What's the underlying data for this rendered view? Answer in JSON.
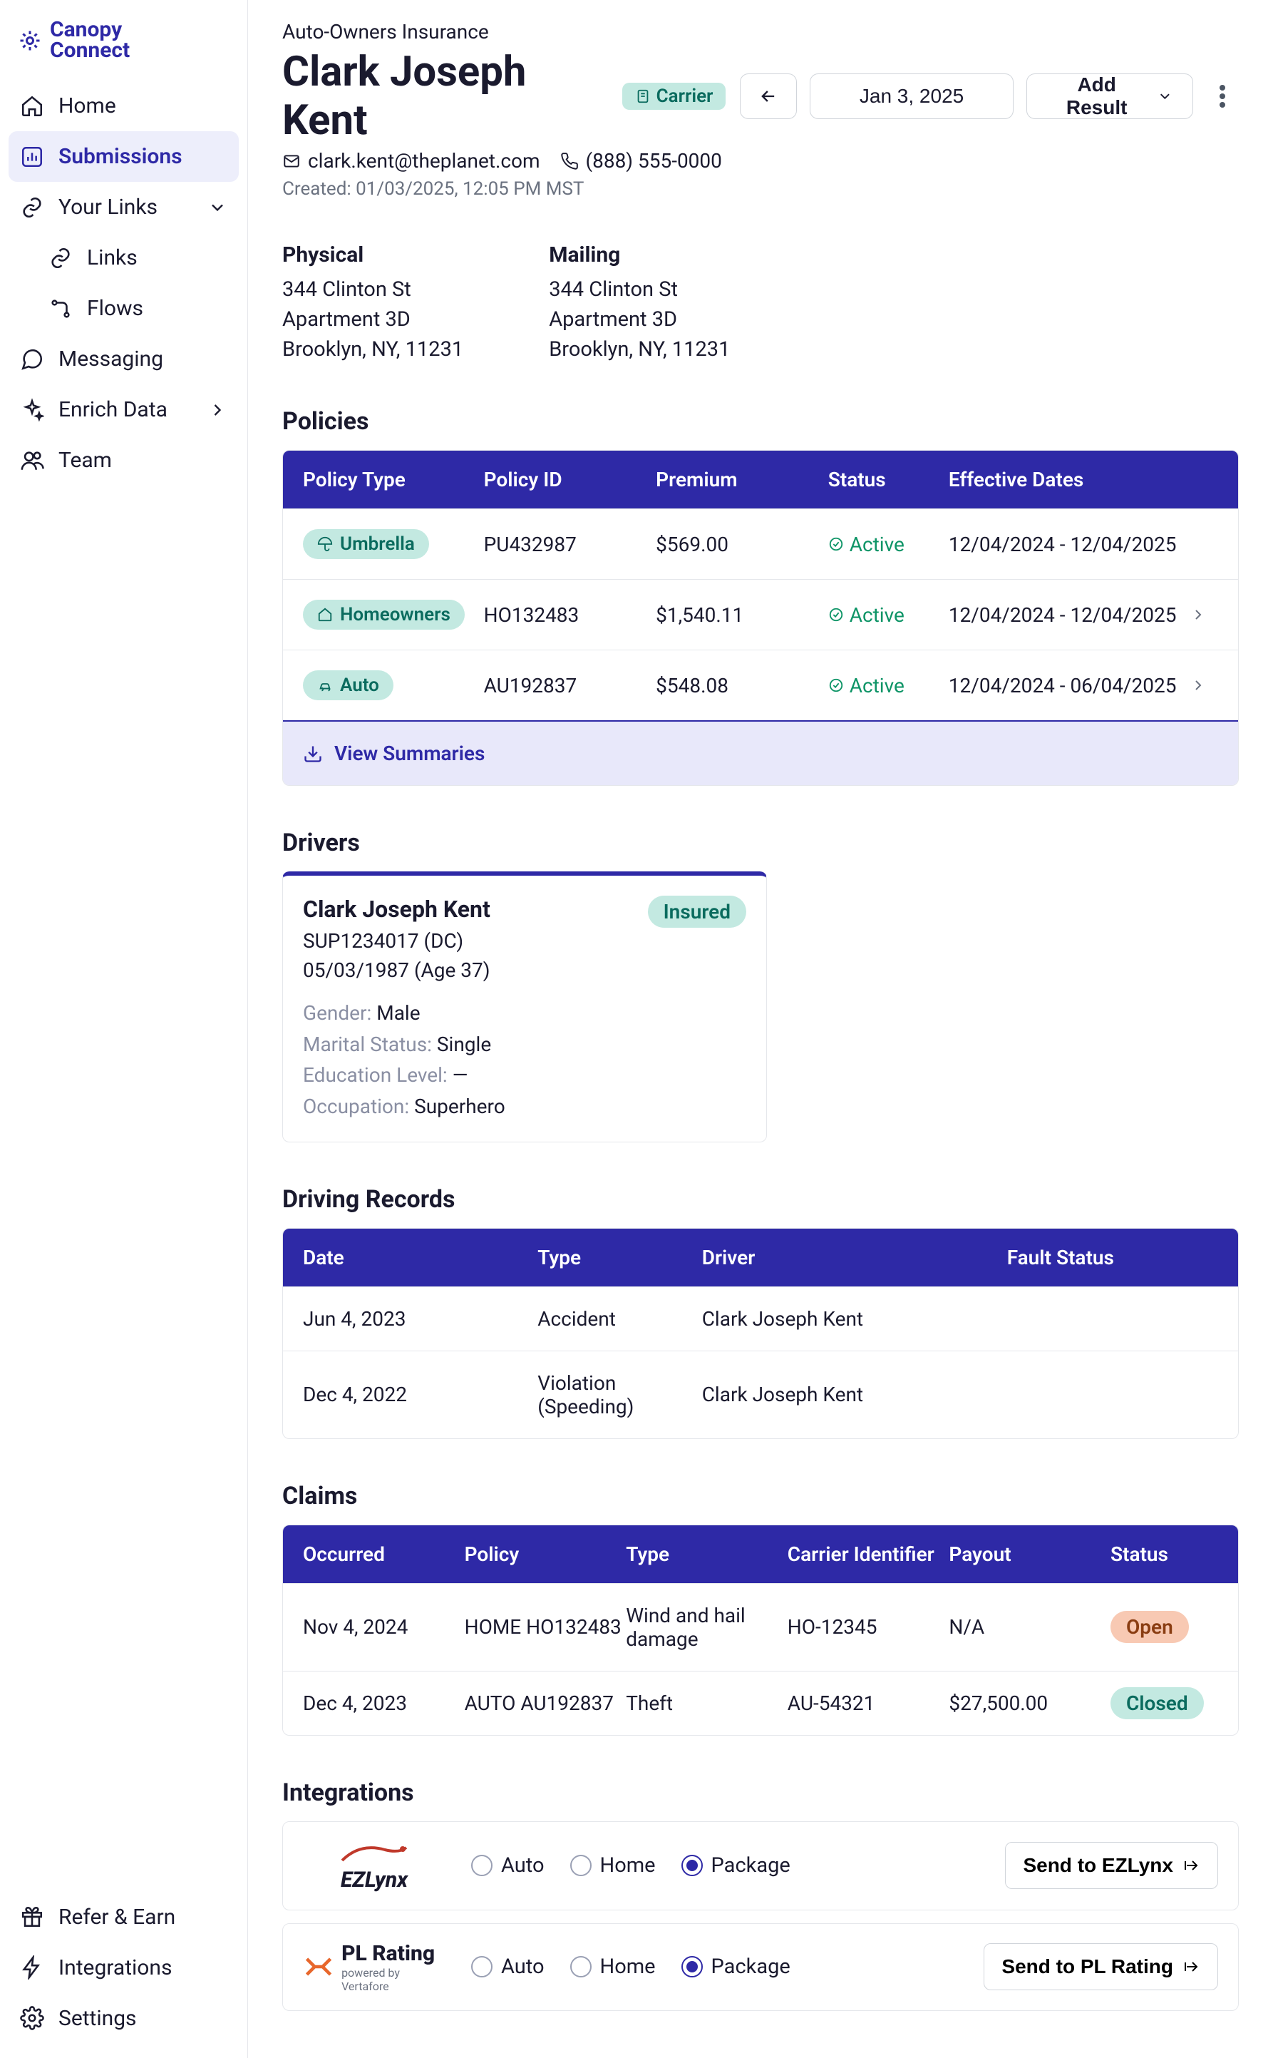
{
  "brand": {
    "name": "Canopy Connect"
  },
  "nav": {
    "home": "Home",
    "submissions": "Submissions",
    "your_links": "Your Links",
    "links": "Links",
    "flows": "Flows",
    "messaging": "Messaging",
    "enrich": "Enrich Data",
    "team": "Team",
    "refer": "Refer & Earn",
    "integrations": "Integrations",
    "settings": "Settings"
  },
  "header": {
    "breadcrumb": "Auto-Owners Insurance",
    "name": "Clark Joseph Kent",
    "carrier_badge": "Carrier",
    "email": "clark.kent@theplanet.com",
    "phone": "(888) 555-0000",
    "created": "Created: 01/03/2025, 12:05 PM MST",
    "date_selected": "Jan 3, 2025",
    "add_result": "Add Result"
  },
  "address": {
    "physical_label": "Physical",
    "mailing_label": "Mailing",
    "physical": {
      "line1": "344 Clinton St",
      "line2": "Apartment 3D",
      "line3": "Brooklyn, NY, 11231"
    },
    "mailing": {
      "line1": "344 Clinton St",
      "line2": "Apartment 3D",
      "line3": "Brooklyn, NY, 11231"
    }
  },
  "policies": {
    "title": "Policies",
    "cols": {
      "type": "Policy Type",
      "id": "Policy ID",
      "premium": "Premium",
      "status": "Status",
      "dates": "Effective Dates"
    },
    "rows": [
      {
        "type": "Umbrella",
        "id": "PU432987",
        "premium": "$569.00",
        "status": "Active",
        "dates": "12/04/2024 - 12/04/2025",
        "has_chevron": false
      },
      {
        "type": "Homeowners",
        "id": "HO132483",
        "premium": "$1,540.11",
        "status": "Active",
        "dates": "12/04/2024 - 12/04/2025",
        "has_chevron": true
      },
      {
        "type": "Auto",
        "id": "AU192837",
        "premium": "$548.08",
        "status": "Active",
        "dates": "12/04/2024 - 06/04/2025",
        "has_chevron": true
      }
    ],
    "view_summaries": "View Summaries"
  },
  "drivers": {
    "title": "Drivers",
    "card": {
      "name": "Clark Joseph Kent",
      "license": "SUP1234017 (DC)",
      "dob": "05/03/1987 (Age 37)",
      "insured": "Insured",
      "gender_lbl": "Gender: ",
      "gender": "Male",
      "marital_lbl": "Marital Status: ",
      "marital": "Single",
      "edu_lbl": "Education Level: ",
      "edu": "—",
      "occ_lbl": "Occupation: ",
      "occ": "Superhero"
    }
  },
  "records": {
    "title": "Driving Records",
    "cols": {
      "date": "Date",
      "type": "Type",
      "driver": "Driver",
      "fault": "Fault Status"
    },
    "rows": [
      {
        "date": "Jun 4, 2023",
        "type": "Accident",
        "driver": "Clark Joseph Kent",
        "fault": ""
      },
      {
        "date": "Dec 4, 2022",
        "type": "Violation (Speeding)",
        "driver": "Clark Joseph Kent",
        "fault": ""
      }
    ]
  },
  "claims": {
    "title": "Claims",
    "cols": {
      "occ": "Occurred",
      "pol": "Policy",
      "type": "Type",
      "cid": "Carrier Identifier",
      "pay": "Payout",
      "stat": "Status"
    },
    "rows": [
      {
        "occ": "Nov 4, 2024",
        "pol": "HOME HO132483",
        "type": "Wind and hail damage",
        "cid": "HO-12345",
        "pay": "N/A",
        "stat": "Open",
        "stat_class": "pill-open"
      },
      {
        "occ": "Dec 4, 2023",
        "pol": "AUTO AU192837",
        "type": "Theft",
        "cid": "AU-54321",
        "pay": "$27,500.00",
        "stat": "Closed",
        "stat_class": "pill-closed"
      }
    ]
  },
  "integrations": {
    "title": "Integrations",
    "radios": {
      "auto": "Auto",
      "home": "Home",
      "package": "Package"
    },
    "rows": [
      {
        "logo": "EZLynx",
        "selected": "Package",
        "send": "Send to EZLynx"
      },
      {
        "logo": "PL Rating",
        "sub": "powered by Vertafore",
        "selected": "Package",
        "send": "Send to PL Rating"
      }
    ]
  }
}
